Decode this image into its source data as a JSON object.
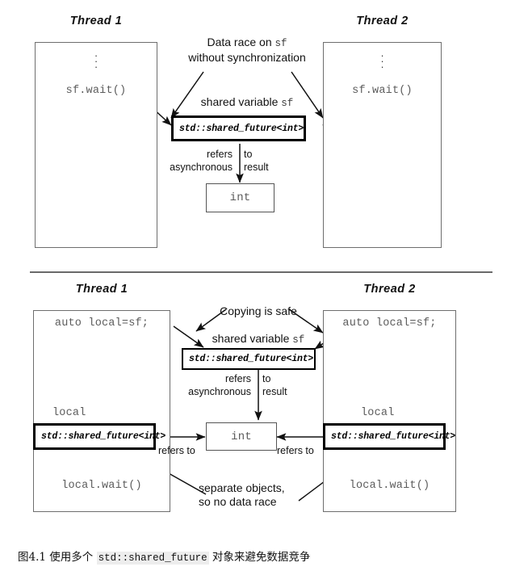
{
  "figure": {
    "caption_prefix": "图4.1 使用多个",
    "caption_code": "std::shared_future",
    "caption_suffix": "对象来避免数据竞争"
  },
  "top_panel": {
    "thread1_label": "Thread  1",
    "thread2_label": "Thread  2",
    "thread1_code": "sf.wait()",
    "thread2_code": "sf.wait()",
    "annotation_race_line1": "Data race on ",
    "annotation_race_mono": "sf",
    "annotation_race_line2": "without synchronization",
    "shared_var_label": "shared variable ",
    "shared_var_mono": "sf",
    "shared_future_text": "std::shared_future<int>",
    "refers_word": "refers",
    "to_word": "to",
    "asynchronous_word": "asynchronous",
    "result_word": "result",
    "int_text": "int"
  },
  "bottom_panel": {
    "thread1_label": "Thread  1",
    "thread2_label": "Thread  2",
    "thread1_code_top": "auto local=sf;",
    "thread2_code_top": "auto local=sf;",
    "copying_label": "Copying is safe",
    "shared_var_label": "shared variable ",
    "shared_var_mono": "sf",
    "shared_future_text": "std::shared_future<int>",
    "refers_word": "refers",
    "to_word": "to",
    "asynchronous_word": "asynchronous",
    "result_word": "result",
    "int_text": "int",
    "local_label_left": "local",
    "local_label_right": "local",
    "local_box_left_text": "std::shared_future<int>",
    "local_box_right_text": "std::shared_future<int>",
    "refers_to_left": "refers to",
    "refers_to_right": "refers to",
    "thread1_code_bottom": "local.wait()",
    "thread2_code_bottom": "local.wait()",
    "separate_line1": "separate objects,",
    "separate_line2": "so no data race"
  },
  "colors": {
    "ink": "#111111",
    "code_gray": "#5c5c5c",
    "box_border": "#6e6e6e",
    "strong_border": "#000000",
    "caption_code_bg": "#ededed"
  }
}
